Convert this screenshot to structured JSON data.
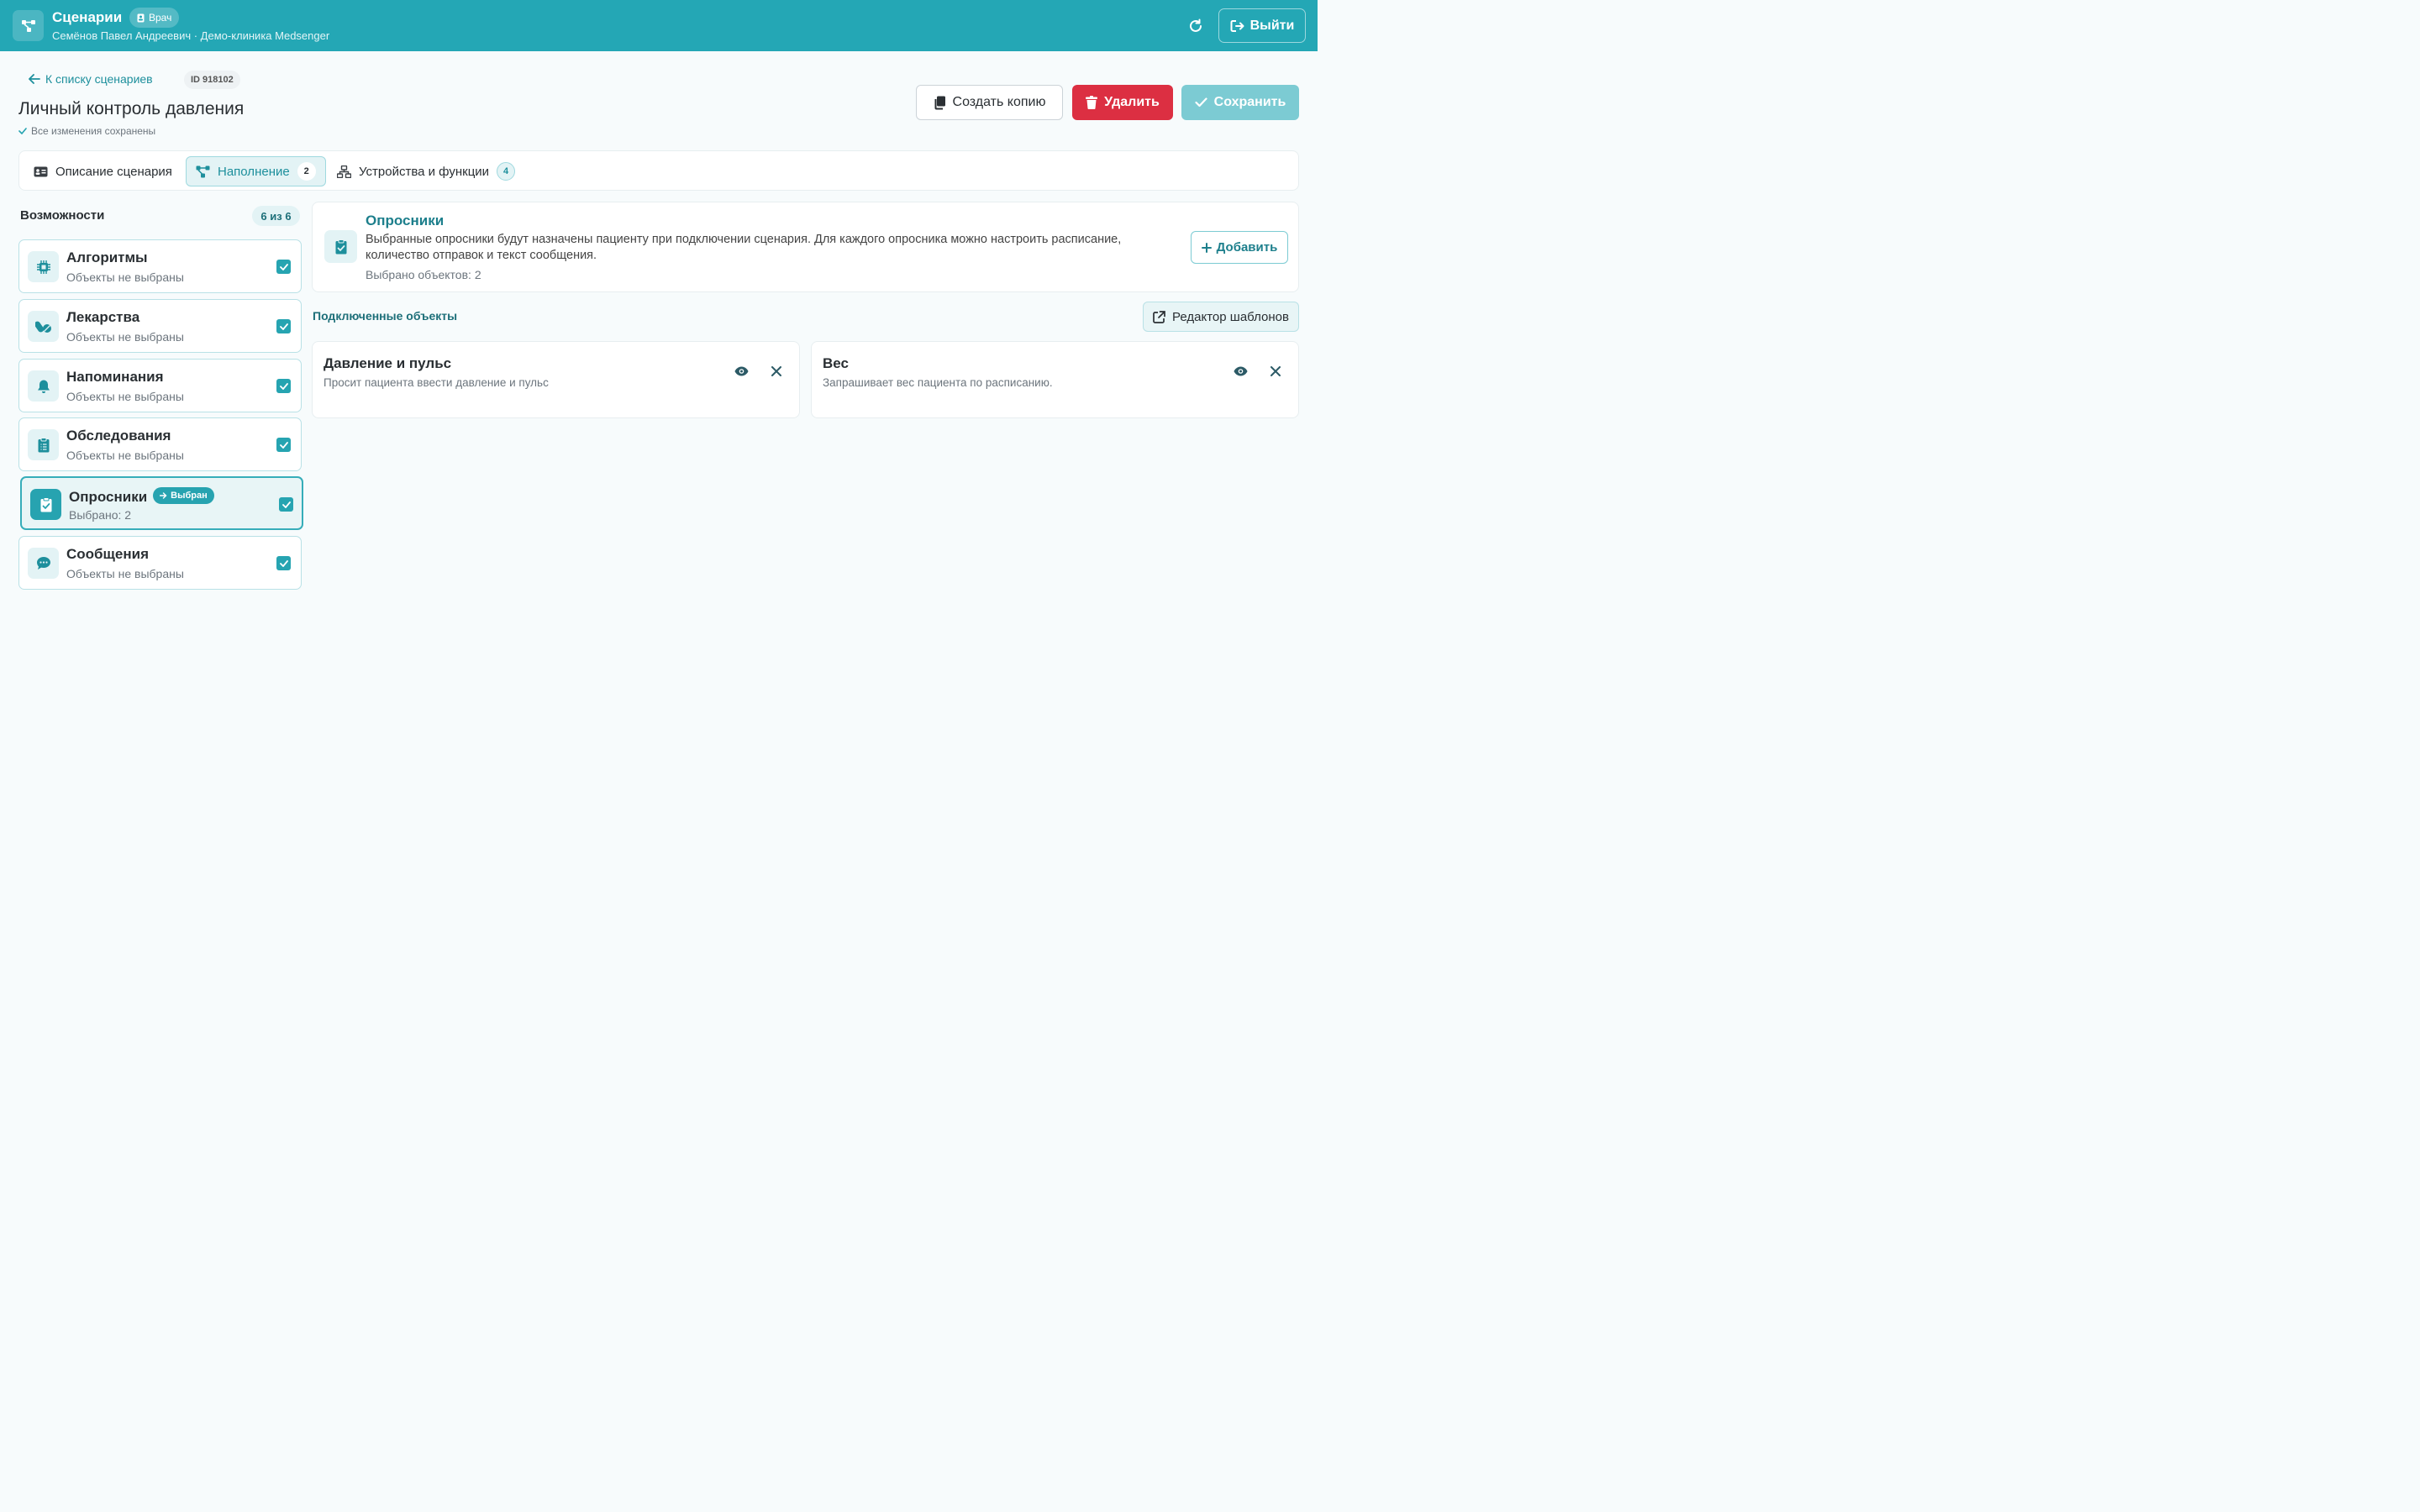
{
  "header": {
    "title": "Сценарии",
    "role_badge": "Врач",
    "subtitle": "Семёнов Павел Андреевич · Демо-клиника Medsenger",
    "logout_label": "Выйти",
    "refresh_icon": "refresh-icon"
  },
  "top": {
    "back_link": "К списку сценариев",
    "id_badge": "ID 918102",
    "page_title": "Личный контроль давления",
    "saved_status": "Все изменения сохранены",
    "copy_label": "Создать копию",
    "delete_label": "Удалить",
    "save_label": "Сохранить"
  },
  "tabs": [
    {
      "label": "Описание сценария",
      "icon": "id-card-icon"
    },
    {
      "label": "Наполнение",
      "count": "2",
      "icon": "diagram-icon"
    },
    {
      "label": "Устройства и функции",
      "count": "4",
      "icon": "network-icon"
    }
  ],
  "sidebar": {
    "title": "Возможности",
    "count": "6 из 6",
    "items": [
      {
        "name": "Алгоритмы",
        "sub": "Объекты не выбраны",
        "icon": "chip-icon"
      },
      {
        "name": "Лекарства",
        "sub": "Объекты не выбраны",
        "icon": "pills-icon"
      },
      {
        "name": "Напоминания",
        "sub": "Объекты не выбраны",
        "icon": "bell-icon"
      },
      {
        "name": "Обследования",
        "sub": "Объекты не выбраны",
        "icon": "clipboard-list-icon"
      },
      {
        "name": "Опросники",
        "sub": "Выбрано: 2",
        "badge": "Выбран",
        "icon": "clipboard-check-icon"
      },
      {
        "name": "Сообщения",
        "sub": "Объекты не выбраны",
        "icon": "chat-icon"
      }
    ]
  },
  "section": {
    "title": "Опросники",
    "description": "Выбранные опросники будут назначены пациенту при подключении сценария. Для каждого опросника можно настроить расписание, количество отправок и текст сообщения.",
    "count": "Выбрано объектов: 2",
    "add_label": "Добавить",
    "connected_title": "Подключенные объекты",
    "editor_label": "Редактор шаблонов"
  },
  "objects": [
    {
      "name": "Давление и пульс",
      "desc": "Просит пациента ввести давление и пульс"
    },
    {
      "name": "Вес",
      "desc": "Запрашивает вес пациента по расписанию."
    }
  ],
  "colors": {
    "brand": "#24a7b5",
    "danger": "#dc2f42",
    "save_disabled": "#7ccbd3"
  }
}
